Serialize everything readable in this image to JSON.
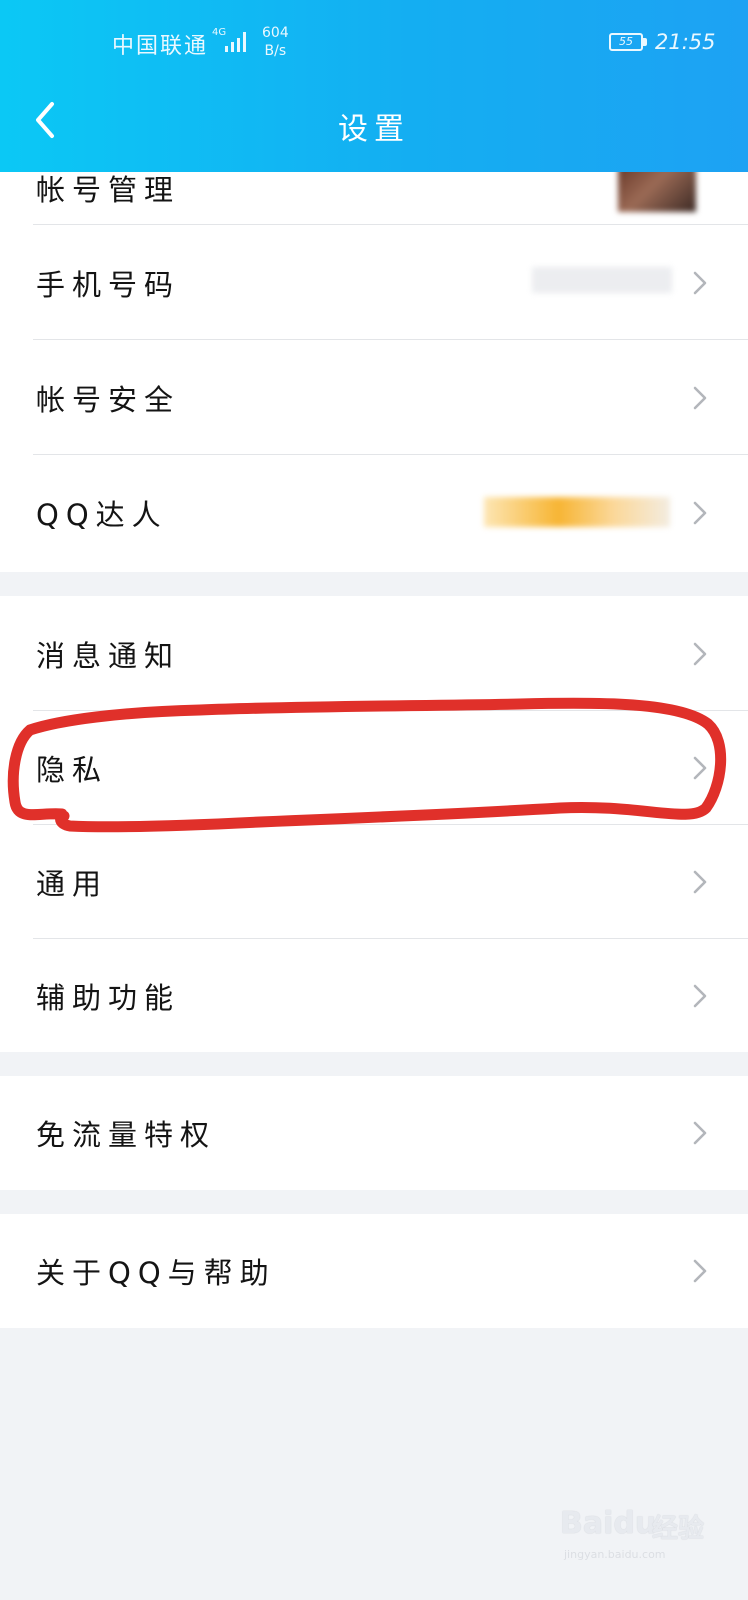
{
  "status_bar": {
    "carrier": "中国联通",
    "network": "4G",
    "speed_value": "604",
    "speed_unit": "B/s",
    "battery": "55",
    "time": "21:55"
  },
  "header": {
    "title": "设置"
  },
  "sections": [
    {
      "items": [
        {
          "label": "帐号管理"
        },
        {
          "label": "手机号码"
        },
        {
          "label": "帐号安全"
        },
        {
          "label": "QQ达人"
        }
      ]
    },
    {
      "items": [
        {
          "label": "消息通知"
        },
        {
          "label": "隐私"
        },
        {
          "label": "通用"
        },
        {
          "label": "辅助功能"
        }
      ]
    },
    {
      "items": [
        {
          "label": "免流量特权"
        }
      ]
    },
    {
      "items": [
        {
          "label": "关于QQ与帮助"
        }
      ]
    }
  ],
  "annotation": {
    "highlight_color": "#e0302a",
    "highlighted_item": "隐私"
  },
  "watermark": {
    "logo": "Baidu",
    "brand_cn": "经验",
    "url": "jingyan.baidu.com"
  }
}
